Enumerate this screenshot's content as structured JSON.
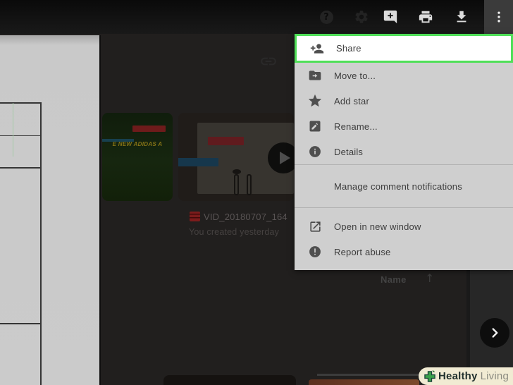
{
  "topbar": {
    "help_glyph": "?",
    "icons": [
      "help-icon",
      "settings-gear-icon",
      "add-comment-icon",
      "print-icon",
      "download-icon",
      "more-vert-icon"
    ]
  },
  "menu": {
    "highlight_color": "#4fdf58",
    "items": [
      {
        "label": "Share",
        "icon": "person-add-icon",
        "highlighted": true
      },
      {
        "label": "Move to...",
        "icon": "folder-move-icon"
      },
      {
        "label": "Add star",
        "icon": "star-icon"
      },
      {
        "label": "Rename...",
        "icon": "rename-icon"
      },
      {
        "label": "Details",
        "icon": "info-icon"
      },
      {
        "label": "Manage comment notifications",
        "icon": null
      },
      {
        "label": "Open in new window",
        "icon": "open-in-new-icon"
      },
      {
        "label": "Report abuse",
        "icon": "report-icon"
      }
    ]
  },
  "content": {
    "file_title": "VID_20180707_164",
    "file_meta": "You created yesterday",
    "adidas_caption": "E NEW ADIDAS A",
    "sort_label": "Name",
    "sort_arrow": "↑",
    "link_icon": "get-link-icon",
    "next_icon": "chevron-right-icon",
    "file_icon": "video-clapper-icon"
  },
  "watermark": {
    "bold": "Healthy",
    "light": "Living",
    "icon": "green-cross-leaf-icon",
    "bg_color": "#f1ebd3",
    "cross_color": "#3aa14b"
  },
  "colors": {
    "topbar_bg": "#0f0f0f",
    "overlay_bg": "#211f1e",
    "menu_bg": "#cfcfcf",
    "menu_text": "#3d3d3d",
    "highlight_row_bg": "#ffffff"
  }
}
